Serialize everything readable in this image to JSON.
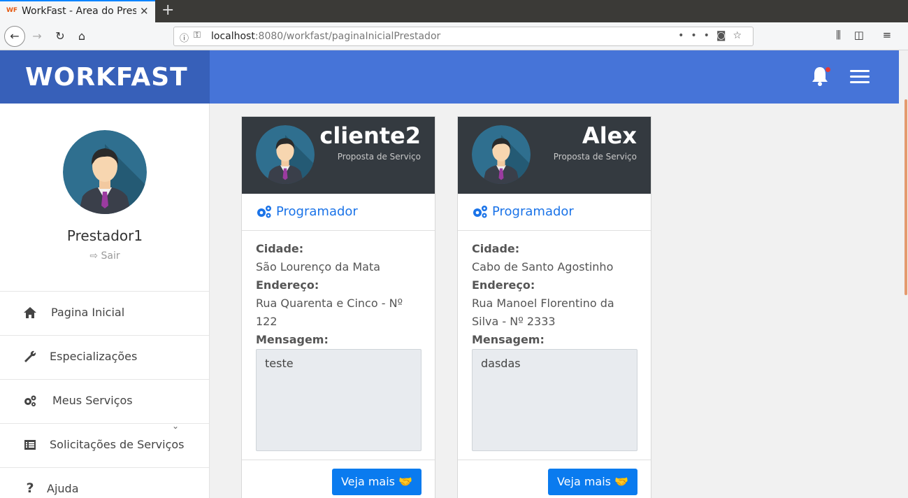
{
  "browser": {
    "tab_title": "WorkFast - Area do Prest",
    "tab_favicon": "WF",
    "url_host": "localhost",
    "url_rest": ":8080/workfast/paginaInicialPrestador"
  },
  "header": {
    "brand": "WORKFAST"
  },
  "sidebar": {
    "profile_name": "Prestador1",
    "logout_label": "Sair",
    "items": [
      {
        "label": "Pagina Inicial",
        "icon": "home-icon"
      },
      {
        "label": "Especializações",
        "icon": "wrench-icon"
      },
      {
        "label": "Meus Serviços",
        "icon": "gears-icon"
      },
      {
        "label": "Solicitações de Serviços",
        "icon": "list-icon"
      },
      {
        "label": "Ajuda",
        "icon": "question-icon"
      }
    ]
  },
  "cards": [
    {
      "name": "cliente2",
      "subtitle": "Proposta de Serviço",
      "role": "Programador",
      "cidade_label": "Cidade:",
      "cidade": "São Lourenço da Mata",
      "endereco_label": "Endereço:",
      "endereco": "Rua Quarenta e Cinco - Nº 122",
      "mensagem_label": "Mensagem:",
      "mensagem": "teste",
      "button": "Veja mais"
    },
    {
      "name": "Alex",
      "subtitle": "Proposta de Serviço",
      "role": "Programador",
      "cidade_label": "Cidade:",
      "cidade": "Cabo de Santo Agostinho",
      "endereco_label": "Endereço:",
      "endereco": "Rua Manoel Florentino da Silva - Nº 2333",
      "mensagem_label": "Mensagem:",
      "mensagem": "dasdas",
      "button": "Veja mais"
    }
  ],
  "colors": {
    "brand": "#3760b9",
    "topbar": "#4674d8",
    "card_header": "#343a40",
    "primary_button": "#0a7bef",
    "link": "#1a73e8"
  }
}
